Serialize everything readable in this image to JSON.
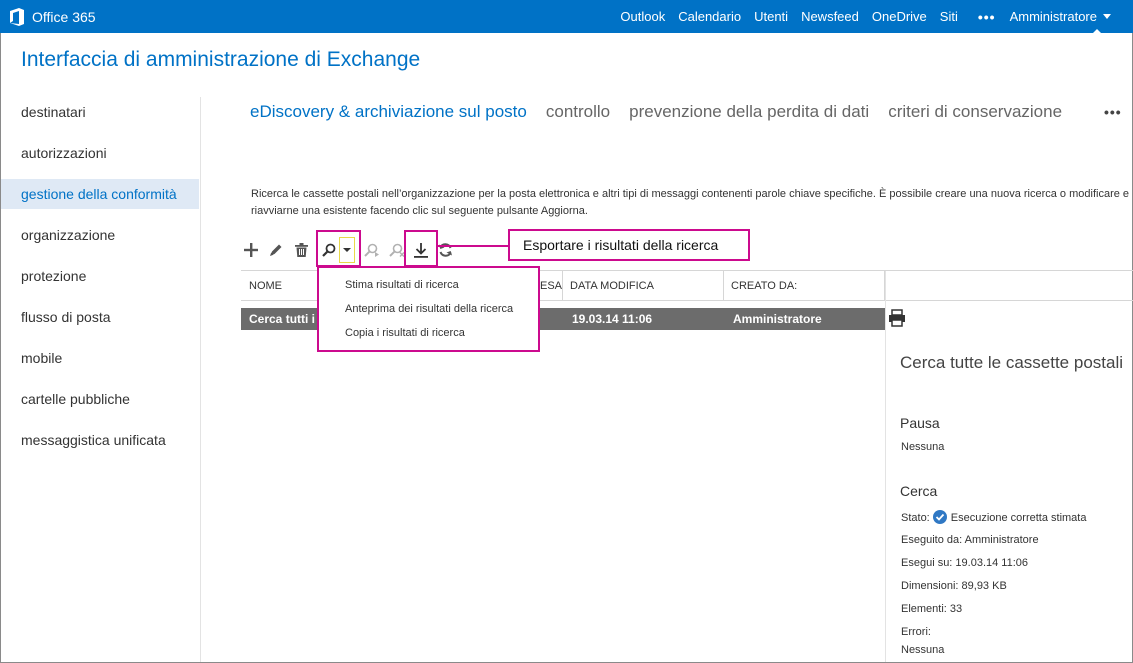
{
  "topbar": {
    "brand": "Office 365",
    "nav": [
      "Outlook",
      "Calendario",
      "Utenti",
      "Newsfeed",
      "OneDrive",
      "Siti"
    ],
    "more": "•••",
    "user": "Amministratore",
    "color": "#0072c6"
  },
  "app_title": "Interfaccia di amministrazione di Exchange",
  "sidebar": {
    "items": [
      {
        "label": "destinatari"
      },
      {
        "label": "autorizzazioni"
      },
      {
        "label": "gestione della conformità",
        "active": true
      },
      {
        "label": "organizzazione"
      },
      {
        "label": "protezione"
      },
      {
        "label": "flusso di posta"
      },
      {
        "label": "mobile"
      },
      {
        "label": "cartelle pubbliche"
      },
      {
        "label": "messaggistica unificata"
      }
    ]
  },
  "tabs": {
    "items": [
      {
        "label": "eDiscovery & archiviazione sul posto",
        "active": true
      },
      {
        "label": "controllo"
      },
      {
        "label": "prevenzione della perdita di dati"
      },
      {
        "label": "criteri di conservazione"
      }
    ],
    "more": "•••"
  },
  "description": "Ricerca le cassette postali nell’organizzazione per la posta elettronica e altri tipi di messaggi contenenti parole chiave specifiche. È possibile creare una nuova ricerca o modificare e riavviarne una esistente facendo clic sul seguente pulsante Aggiorna.",
  "toolbar": {
    "icons": [
      "add-icon",
      "edit-icon",
      "delete-icon",
      "search-icon",
      "dropdown-caret-icon",
      "search-forward-icon",
      "search-stop-icon",
      "export-icon",
      "refresh-icon"
    ]
  },
  "callout": "Esportare i risultati della ricerca",
  "dropdown_menu": {
    "items": [
      "Stima risultati di ricerca",
      "Anteprima dei risultati della ricerca",
      "Copia i risultati di ricerca"
    ]
  },
  "table": {
    "headers": {
      "name": "NOME",
      "status_partial": "ESA",
      "modified": "DATA MODIFICA",
      "created_by": "CREATO DA:"
    },
    "row": {
      "name": "Cerca tutti i",
      "modified": "19.03.14 11:06",
      "created_by": "Amministratore"
    }
  },
  "details": {
    "title": "Cerca tutte le cassette postali",
    "pause_heading": "Pausa",
    "pause_value": "Nessuna",
    "search_heading": "Cerca",
    "status_label": "Stato:",
    "status_value": "Esecuzione corretta stimata",
    "run_by": "Eseguito da:  Amministratore",
    "run_on": "Esegui su: 19.03.14 11:06",
    "size": "Dimensioni: 89,93 KB",
    "items": "Elementi: 33",
    "errors_label": "Errori:",
    "errors_value": "Nessuna"
  },
  "colors": {
    "accent": "#0072c6",
    "highlight": "#cc0a8e",
    "selected_row": "#6c6c6c",
    "active_nav_bg": "#dfe9f5"
  }
}
